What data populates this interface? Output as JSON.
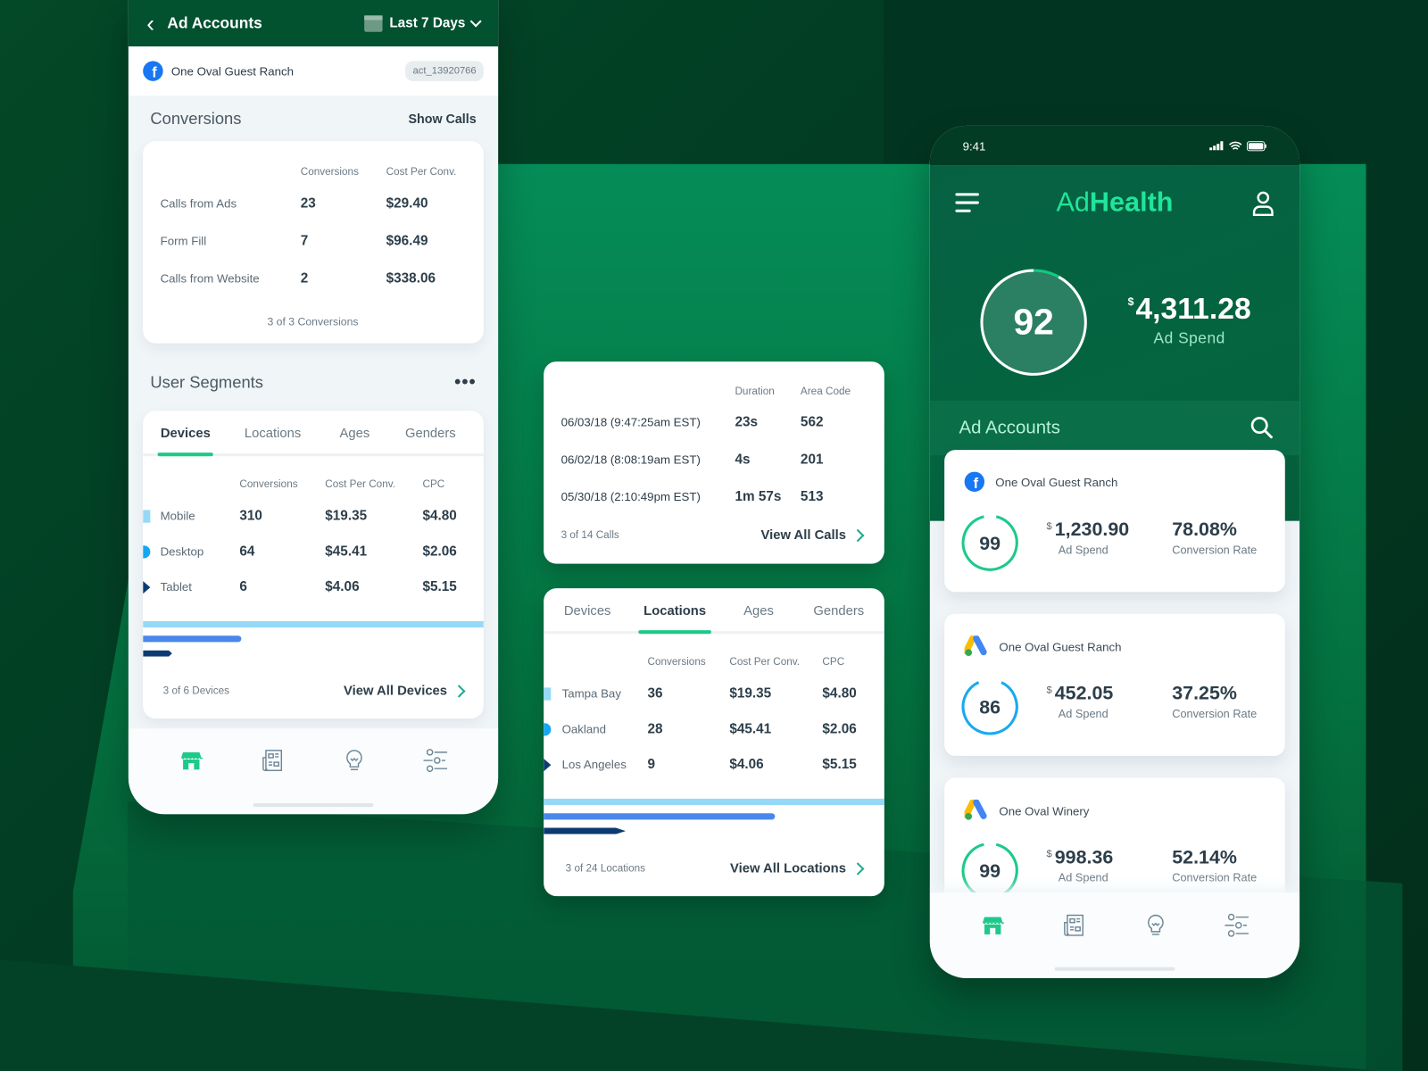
{
  "left_phone": {
    "header": {
      "back_icon": "chevron-left-icon",
      "title": "Ad Accounts",
      "calendar_icon": "calendar-icon",
      "date_range": "Last 7 Days",
      "dropdown_icon": "chevron-down-icon"
    },
    "account": {
      "platform": "facebook",
      "name": "One Oval Guest Ranch",
      "id": "act_13920766"
    },
    "conversions": {
      "title": "Conversions",
      "action": "Show Calls",
      "columns": [
        "Conversions",
        "Cost Per Conv."
      ],
      "rows": [
        {
          "label": "Calls from Ads",
          "conversions": "23",
          "cost": "$29.40"
        },
        {
          "label": "Form Fill",
          "conversions": "7",
          "cost": "$96.49"
        },
        {
          "label": "Calls from Website",
          "conversions": "2",
          "cost": "$338.06"
        }
      ],
      "footer": "3 of 3 Conversions"
    },
    "segments": {
      "title": "User Segments",
      "more_icon": "more-horizontal-icon",
      "tabs": [
        "Devices",
        "Locations",
        "Ages",
        "Genders"
      ],
      "active_tab": "Devices",
      "columns": [
        "Conversions",
        "Cost Per Conv.",
        "CPC"
      ],
      "rows": [
        {
          "label": "Mobile",
          "conversions": "310",
          "cost": "$19.35",
          "cpc": "$4.80",
          "share": 1.0
        },
        {
          "label": "Desktop",
          "conversions": "64",
          "cost": "$45.41",
          "cpc": "$2.06",
          "share": 0.29
        },
        {
          "label": "Tablet",
          "conversions": "6",
          "cost": "$4.06",
          "cpc": "$5.15",
          "share": 0.085
        }
      ],
      "footer": "3 of 6 Devices",
      "view_all": "View All Devices"
    },
    "nav": [
      "store-icon",
      "newspaper-icon",
      "lightbulb-icon",
      "sliders-icon"
    ],
    "active_nav": "store-icon"
  },
  "calls_card": {
    "columns": [
      "Duration",
      "Area Code"
    ],
    "rows": [
      {
        "date": "06/03/18 (9:47:25am EST)",
        "duration": "23s",
        "area": "562"
      },
      {
        "date": "06/02/18 (8:08:19am EST)",
        "duration": "4s",
        "area": "201"
      },
      {
        "date": "05/30/18 (2:10:49pm EST)",
        "duration": "1m 57s",
        "area": "513"
      }
    ],
    "footer": "3 of 14 Calls",
    "view_all": "View All Calls"
  },
  "locations_card": {
    "tabs": [
      "Devices",
      "Locations",
      "Ages",
      "Genders"
    ],
    "active_tab": "Locations",
    "columns": [
      "Conversions",
      "Cost Per Conv.",
      "CPC"
    ],
    "rows": [
      {
        "label": "Tampa Bay",
        "conversions": "36",
        "cost": "$19.35",
        "cpc": "$4.80",
        "share": 1.0
      },
      {
        "label": "Oakland",
        "conversions": "28",
        "cost": "$45.41",
        "cpc": "$2.06",
        "share": 0.68
      },
      {
        "label": "Los Angeles",
        "conversions": "9",
        "cost": "$4.06",
        "cpc": "$5.15",
        "share": 0.24
      }
    ],
    "footer": "3 of 24 Locations",
    "view_all": "View All Locations"
  },
  "right_phone": {
    "status": {
      "time": "9:41",
      "icons": [
        "signal-icon",
        "wifi-icon",
        "battery-icon"
      ]
    },
    "brand": {
      "light": "Ad",
      "bold": "Health"
    },
    "menu_icon": "menu-icon",
    "user_icon": "user-icon",
    "score": {
      "value": "92",
      "fraction": 0.92
    },
    "spend": {
      "currency": "$",
      "amount": "4,311.28",
      "label": "Ad Spend"
    },
    "accounts_title": "Ad Accounts",
    "search_icon": "search-icon",
    "colors": {
      "accent": "#20e59a",
      "good": "#1ec98a",
      "mid": "#1aa9ef"
    },
    "accounts": [
      {
        "platform": "facebook",
        "name": "One Oval Guest Ranch",
        "score": "99",
        "fraction": 0.99,
        "color": "#1ec98a",
        "currency": "$",
        "spend": "1,230.90",
        "spend_label": "Ad Spend",
        "rate": "78.08%",
        "rate_label": "Conversion Rate"
      },
      {
        "platform": "google-ads",
        "name": "One Oval Guest Ranch",
        "score": "86",
        "fraction": 0.86,
        "color": "#1aa9ef",
        "currency": "$",
        "spend": "452.05",
        "spend_label": "Ad Spend",
        "rate": "37.25%",
        "rate_label": "Conversion Rate"
      },
      {
        "platform": "google-ads",
        "name": "One Oval Winery",
        "score": "99",
        "fraction": 0.99,
        "color": "#1ec98a",
        "currency": "$",
        "spend": "998.36",
        "spend_label": "Ad Spend",
        "rate": "52.14%",
        "rate_label": "Conversion Rate"
      }
    ],
    "nav": [
      "store-icon",
      "newspaper-icon",
      "lightbulb-icon",
      "sliders-icon"
    ],
    "active_nav": "store-icon"
  }
}
